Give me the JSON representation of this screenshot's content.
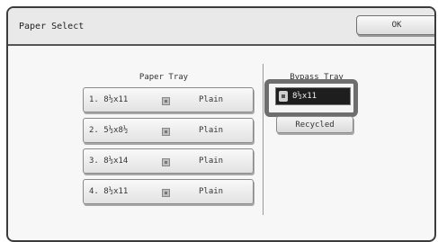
{
  "window": {
    "title": "Paper Select",
    "ok_label": "OK"
  },
  "paper_tray": {
    "header": "Paper Tray",
    "trays": [
      {
        "size": "1. 8½x11",
        "type": "Plain"
      },
      {
        "size": "2. 5½x8½",
        "type": "Plain"
      },
      {
        "size": "3. 8½x14",
        "type": "Plain"
      },
      {
        "size": "4. 8½x11",
        "type": "Plain"
      }
    ]
  },
  "bypass_tray": {
    "header": "Bypass Tray",
    "selected_size": "8½x11",
    "type": "Recycled"
  },
  "icons": {
    "paper_tray_icon": "paper-tray-icon",
    "bypass_icon": "bypass-tray-icon"
  }
}
